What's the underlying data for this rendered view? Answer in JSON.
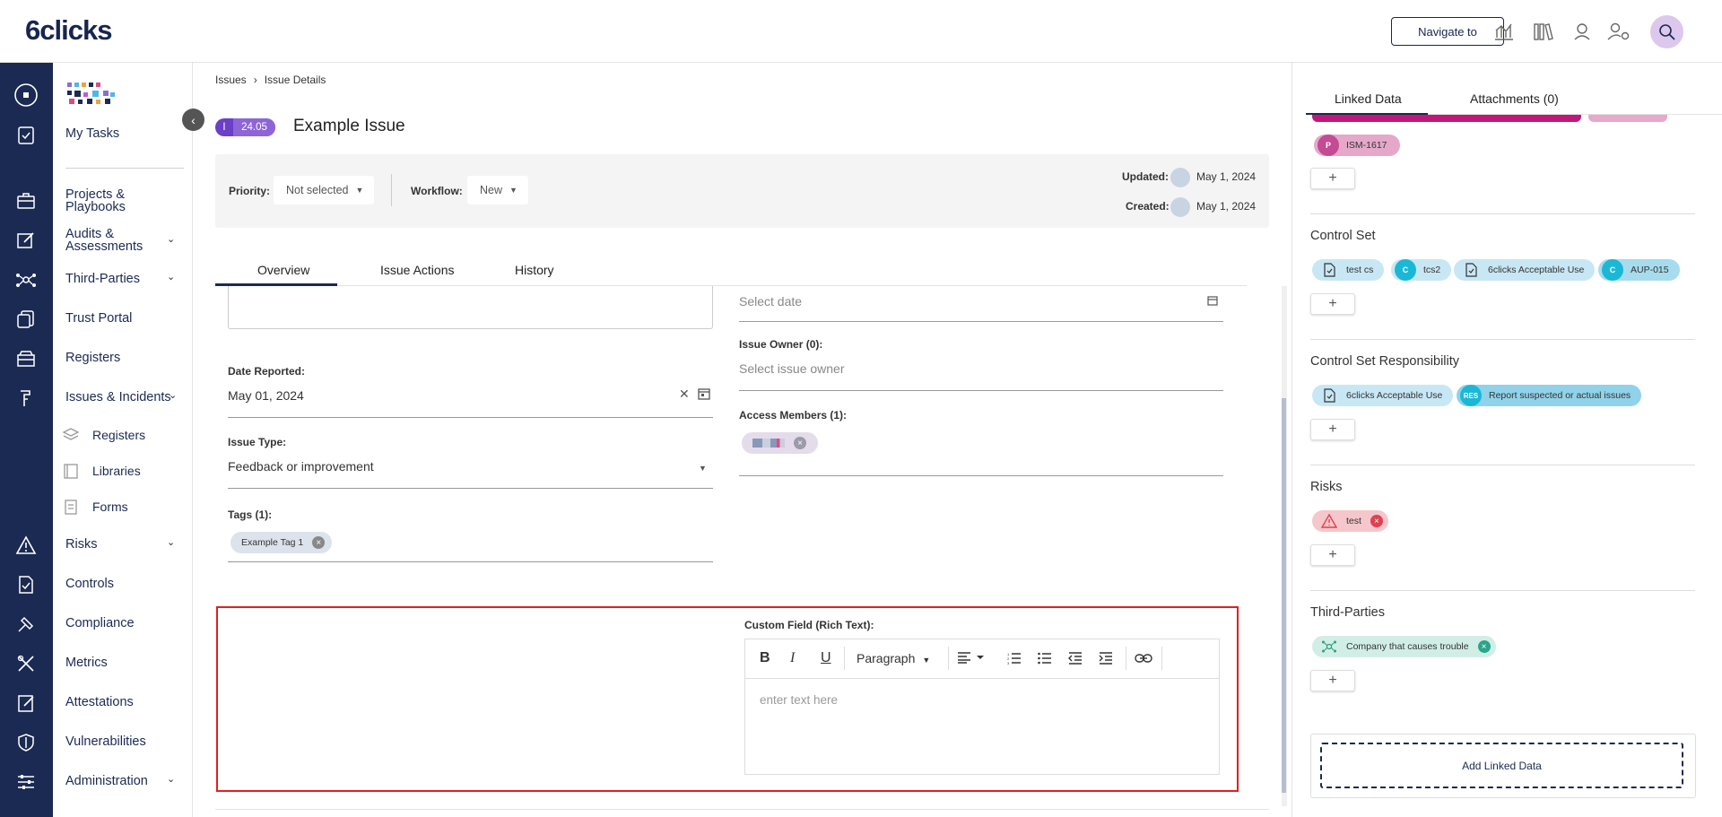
{
  "app": {
    "logo": "6clicks",
    "navigate_label": "Navigate to"
  },
  "top_icons": [
    "analytics-icon",
    "library-icon",
    "user-icon",
    "user-settings-icon",
    "search-user-icon"
  ],
  "sidebar": {
    "items": {
      "my_tasks": "My Tasks",
      "projects": "Projects & Playbooks",
      "audits": "Audits & Assessments",
      "third_parties": "Third-Parties",
      "trust_portal": "Trust Portal",
      "registers": "Registers",
      "issues": "Issues & Incidents",
      "sub_registers": "Registers",
      "sub_libraries": "Libraries",
      "sub_forms": "Forms",
      "risks": "Risks",
      "controls": "Controls",
      "compliance": "Compliance",
      "metrics": "Metrics",
      "attestations": "Attestations",
      "vulnerabilities": "Vulnerabilities",
      "administration": "Administration"
    }
  },
  "breadcrumb": {
    "first": "Issues",
    "second": "Issue Details"
  },
  "issue": {
    "badge_letter": "I",
    "badge_number": "24.05",
    "title": "Example Issue",
    "priority_label": "Priority:",
    "priority_value": "Not selected",
    "workflow_label": "Workflow:",
    "workflow_value": "New",
    "updated_label": "Updated:",
    "updated_date": "May 1, 2024",
    "created_label": "Created:",
    "created_date": "May 1, 2024"
  },
  "tabs": {
    "overview": "Overview",
    "actions": "Issue Actions",
    "history": "History"
  },
  "form": {
    "select_date_placeholder": "Select date",
    "date_reported_label": "Date Reported:",
    "date_reported_value": "May 01, 2024",
    "issue_owner_label": "Issue Owner (0):",
    "issue_owner_placeholder": "Select issue owner",
    "access_members_label": "Access Members (1):",
    "issue_type_label": "Issue Type:",
    "issue_type_value": "Feedback or improvement",
    "tags_label": "Tags (1):",
    "tag_1": "Example Tag 1",
    "custom_field_label": "Custom Field (Rich Text):",
    "paragraph_label": "Paragraph",
    "rich_placeholder": "enter text here"
  },
  "right_panel": {
    "tab_linked": "Linked Data",
    "tab_attachments": "Attachments (0)",
    "ism_letter": "P",
    "ism_label": "ISM-1617",
    "control_set_title": "Control Set",
    "cs_chip_1": "test cs",
    "cs_chip_2_letter": "C",
    "cs_chip_2": "tcs2",
    "cs_chip_3": "6clicks Acceptable Use",
    "cs_chip_4_letter": "C",
    "cs_chip_4": "AUP-015",
    "csr_title": "Control Set Responsibility",
    "csr_chip_1": "6clicks Acceptable Use",
    "csr_chip_2_letter": "RES",
    "csr_chip_2": "Report suspected or actual issues",
    "risks_title": "Risks",
    "risk_chip": "test",
    "third_parties_title": "Third-Parties",
    "tp_chip": "Company that causes trouble",
    "add_linked_label": "Add Linked Data"
  },
  "colors": {
    "navy": "#1b2a52",
    "purple": "#6b3fc7",
    "pink": "#c2177a",
    "cyan": "#1bb8d6",
    "light_blue": "#c8e7f4",
    "risk_red": "#e04050",
    "teal_chip": "#d1eee6",
    "highlight_red": "#e02020"
  }
}
